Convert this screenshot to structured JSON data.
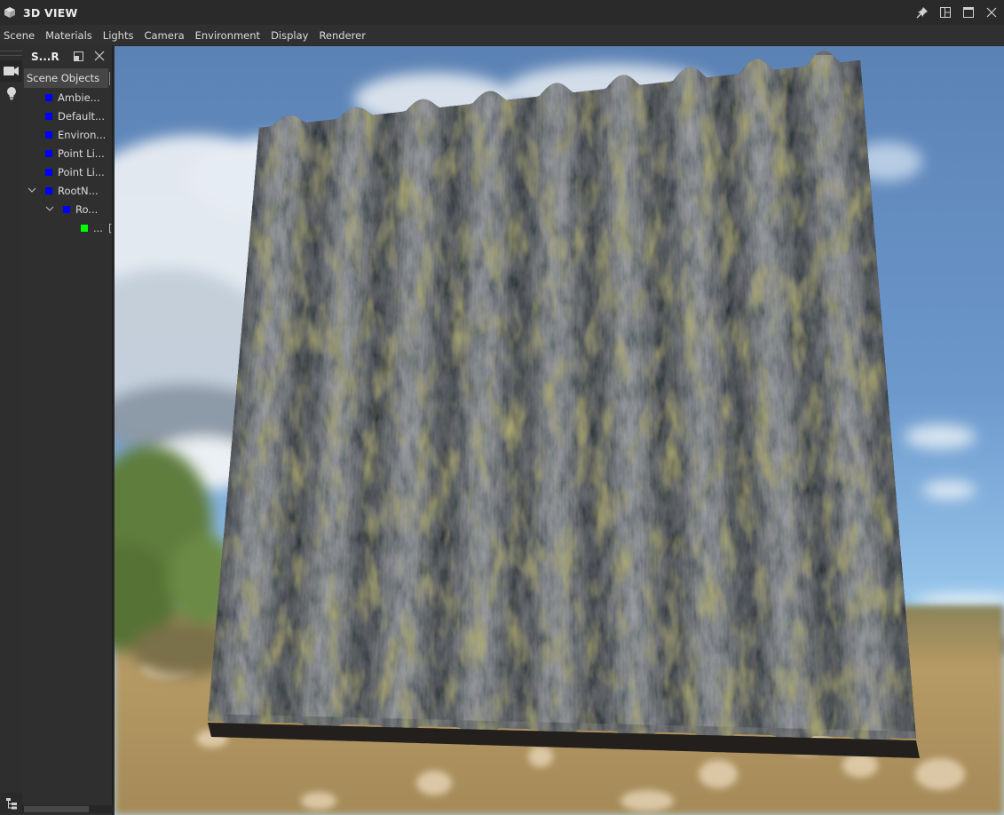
{
  "window": {
    "title": "3D VIEW",
    "icon": "cube-icon",
    "controls": [
      {
        "name": "pin-button",
        "icon": "pin-icon"
      },
      {
        "name": "layout-button",
        "icon": "layout-icon"
      },
      {
        "name": "maximize-button",
        "icon": "maximize-icon"
      },
      {
        "name": "close-button",
        "icon": "close-icon"
      }
    ]
  },
  "menu": {
    "items": [
      "Scene",
      "Materials",
      "Lights",
      "Camera",
      "Environment",
      "Display",
      "Renderer"
    ]
  },
  "left_toolbar": {
    "buttons": [
      {
        "name": "camera-tool",
        "icon": "camera-icon",
        "active": true
      },
      {
        "name": "light-tool",
        "icon": "lightbulb-icon",
        "active": false
      }
    ],
    "bottom_button": {
      "name": "scene-tree-toggle",
      "icon": "hierarchy-icon"
    }
  },
  "scene_panel": {
    "title": "S...R",
    "column_header": "Scene Objects",
    "tree": [
      {
        "label": "Ambie...",
        "color": "#0000ff",
        "depth": 0,
        "expandable": false
      },
      {
        "label": "Default...",
        "color": "#0000ff",
        "depth": 0,
        "expandable": false
      },
      {
        "label": "Environ...",
        "color": "#0000ff",
        "depth": 0,
        "expandable": false
      },
      {
        "label": "Point Li...",
        "color": "#0000ff",
        "depth": 0,
        "expandable": false
      },
      {
        "label": "Point Li...",
        "color": "#0000ff",
        "depth": 0,
        "expandable": false
      },
      {
        "label": "RootN...",
        "color": "#0000ff",
        "depth": 0,
        "expandable": true,
        "expanded": true
      },
      {
        "label": "Ro...",
        "color": "#0000ff",
        "depth": 1,
        "expandable": true,
        "expanded": true
      },
      {
        "label": "...",
        "color": "#00ff00",
        "depth": 2,
        "expandable": false,
        "extra": "["
      }
    ]
  },
  "viewport": {
    "scene": "corrugated-mossy-sheet-over-landscape",
    "colors": {
      "sky_top": "#5f86b8",
      "sky_bottom": "#9fd0f0",
      "cloud": "#e8eef4",
      "ground": "#b89b6a",
      "trees": "#5a7a3a",
      "sheet_dark": "#1f1e20",
      "sheet_mid": "#4a4648",
      "sheet_light": "#9b97a0",
      "moss": "#6e6a2c"
    }
  }
}
